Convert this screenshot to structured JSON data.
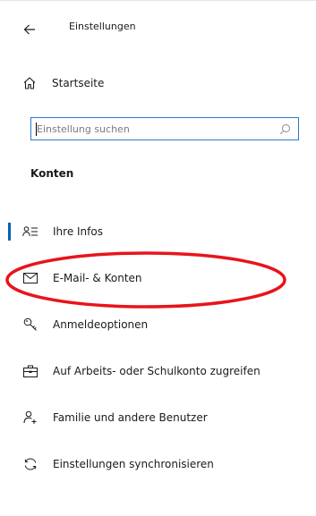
{
  "header": {
    "back_icon": "back-arrow-icon",
    "title": "Einstellungen"
  },
  "home": {
    "icon": "home-icon",
    "label": "Startseite"
  },
  "search": {
    "placeholder": "Einstellung suchen",
    "icon": "search-icon",
    "focused": true
  },
  "section": {
    "heading": "Konten"
  },
  "nav": {
    "items": [
      {
        "label": "Ihre Infos",
        "icon": "person-list-icon",
        "active": true
      },
      {
        "label": "E-Mail- & Konten",
        "icon": "mail-icon",
        "active": false
      },
      {
        "label": "Anmeldeoptionen",
        "icon": "key-icon",
        "active": false
      },
      {
        "label": "Auf Arbeits- oder Schulkonto zugreifen",
        "icon": "briefcase-icon",
        "active": false
      },
      {
        "label": "Familie und andere Benutzer",
        "icon": "add-person-icon",
        "active": false
      },
      {
        "label": "Einstellungen synchronisieren",
        "icon": "sync-icon",
        "active": false
      }
    ]
  },
  "colors": {
    "accent": "#0063b1",
    "search_border": "#2b79d1",
    "annotation": "#e8141b"
  }
}
